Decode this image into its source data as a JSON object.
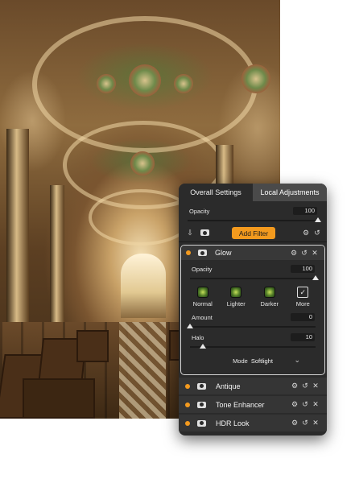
{
  "tabs": {
    "overall": "Overall Settings",
    "local": "Local Adjustments"
  },
  "global": {
    "opacity_label": "Opacity",
    "opacity_value": "100",
    "opacity_level": 1.0,
    "add_filter_label": "Add Filter"
  },
  "glow": {
    "name": "Glow",
    "opacity_label": "Opacity",
    "opacity_value": "100",
    "opacity_level": 1.0,
    "presets": [
      "Normal",
      "Lighter",
      "Darker",
      "More"
    ],
    "amount_label": "Amount",
    "amount_value": "0",
    "amount_level": 0.0,
    "halo_label": "Halo",
    "halo_value": "10",
    "halo_level": 0.1,
    "mode_label": "Mode",
    "mode_value": "Softlight"
  },
  "layers": [
    "Antique",
    "Tone Enhancer",
    "HDR Look"
  ],
  "colors": {
    "accent": "#f39a1e",
    "panel_bg": "#2b2b2b"
  },
  "icons": {
    "layer_toggle": "camera-icon",
    "settings": "gear-icon",
    "reset": "reset-icon",
    "close": "close-icon"
  }
}
